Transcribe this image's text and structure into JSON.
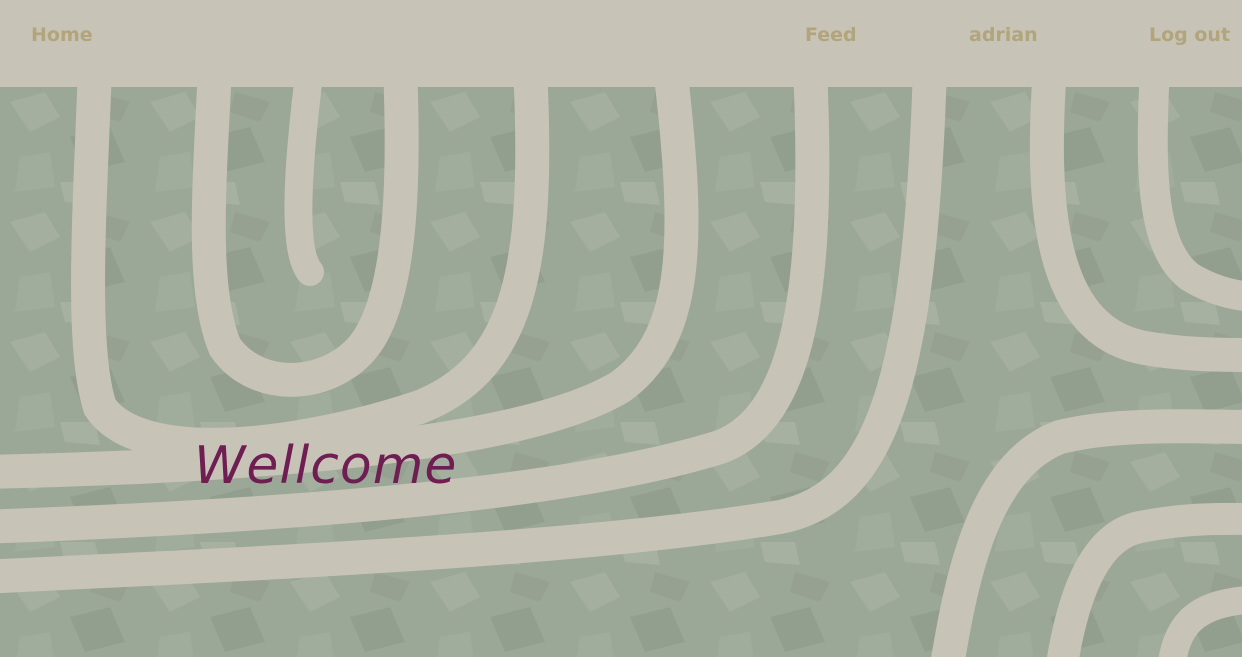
{
  "nav": {
    "home_label": "Home",
    "feed_label": "Feed",
    "user_label": "adrian",
    "logout_label": "Log out"
  },
  "hero": {
    "heading": "Wellcome",
    "image_name": "organic-stripes-background"
  },
  "colors": {
    "background": "#c7c3b7",
    "nav_link": "#b2a47b",
    "heading": "#6e1e52",
    "stripe_green": "#9ba797",
    "stripe_dark": "#8b9686"
  }
}
